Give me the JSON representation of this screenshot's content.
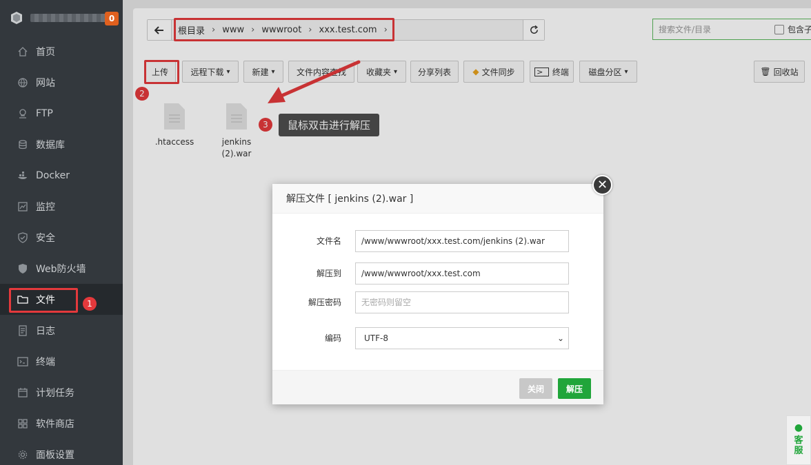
{
  "sidebar": {
    "badge": "0",
    "items": [
      {
        "label": "首页",
        "icon": "home-icon"
      },
      {
        "label": "网站",
        "icon": "globe-icon"
      },
      {
        "label": "FTP",
        "icon": "ftp-icon"
      },
      {
        "label": "数据库",
        "icon": "database-icon"
      },
      {
        "label": "Docker",
        "icon": "docker-icon"
      },
      {
        "label": "监控",
        "icon": "monitor-icon"
      },
      {
        "label": "安全",
        "icon": "shield-icon"
      },
      {
        "label": "Web防火墙",
        "icon": "firewall-icon"
      },
      {
        "label": "文件",
        "icon": "folder-icon"
      },
      {
        "label": "日志",
        "icon": "log-icon"
      },
      {
        "label": "终端",
        "icon": "terminal-icon"
      },
      {
        "label": "计划任务",
        "icon": "calendar-icon"
      },
      {
        "label": "软件商店",
        "icon": "grid-icon"
      },
      {
        "label": "面板设置",
        "icon": "gear-icon"
      }
    ]
  },
  "path": {
    "crumbs": [
      "根目录",
      "www",
      "wwwroot",
      "xxx.test.com"
    ],
    "sep": "›"
  },
  "search": {
    "placeholder": "搜索文件/目录",
    "include_sub": "包含子"
  },
  "toolbar": {
    "upload": "上传",
    "remote_download": "远程下载",
    "new": "新建",
    "content_search": "文件内容查找",
    "favorites": "收藏夹",
    "share_list": "分享列表",
    "file_sync": "文件同步",
    "terminal": "终端",
    "disk_partition": "磁盘分区",
    "recycle_bin": "回收站"
  },
  "files": [
    {
      "name": ".htaccess"
    },
    {
      "name": "jenkins (2).war"
    }
  ],
  "annotations": {
    "n1": "1",
    "n2": "2",
    "n3": "3",
    "tip": "鼠标双击进行解压"
  },
  "dialog": {
    "title": "解压文件 [ jenkins (2).war ]",
    "fields": {
      "filename_label": "文件名",
      "filename_value": "/www/wwwroot/xxx.test.com/jenkins (2).war",
      "extract_to_label": "解压到",
      "extract_to_value": "/www/wwwroot/xxx.test.com",
      "password_label": "解压密码",
      "password_placeholder": "无密码则留空",
      "encoding_label": "编码",
      "encoding_value": "UTF-8"
    },
    "close_label": "关闭",
    "extract_label": "解压"
  },
  "kefu": {
    "line1": "客",
    "line2": "服"
  },
  "colors": {
    "accent": "#20a53a",
    "annotation": "#e4393c",
    "sidebar": "#33383d",
    "badge": "#e0601e"
  }
}
